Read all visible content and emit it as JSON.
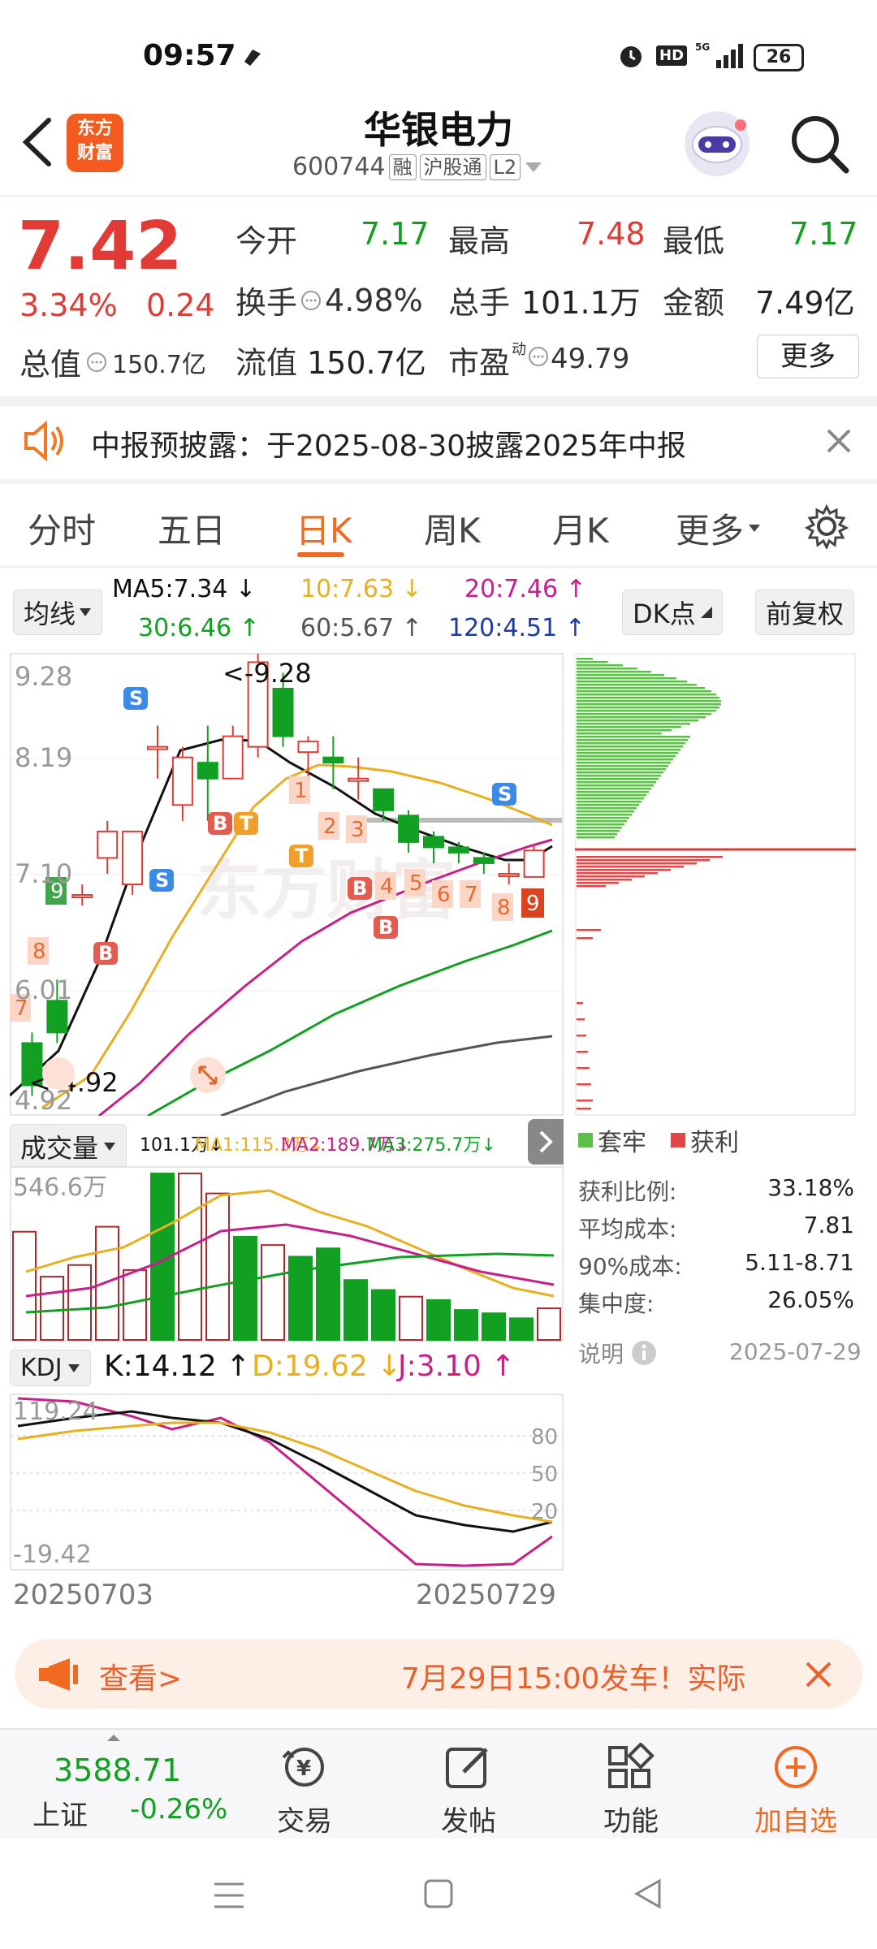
{
  "status": {
    "time": "09:57",
    "battery": "26"
  },
  "header": {
    "title": "华银电力",
    "code": "600744",
    "tags": [
      "融",
      "沪股通",
      "L2"
    ],
    "brand_line1": "东方",
    "brand_line2": "财富"
  },
  "quote": {
    "price": "7.42",
    "change_pct": "3.34%",
    "change_amt": "0.24",
    "open_label": "今开",
    "open": "7.17",
    "high_label": "最高",
    "high": "7.48",
    "low_label": "最低",
    "low": "7.17",
    "turnover_label": "换手",
    "turnover": "4.98%",
    "volume_label": "总手",
    "volume": "101.1万",
    "amount_label": "金额",
    "amount": "7.49亿",
    "mktcap_label": "总值",
    "mktcap": "150.7亿",
    "float_label": "流值",
    "float": "150.7亿",
    "pe_label": "市盈",
    "pe_sup": "动",
    "pe": "49.79",
    "more_button": "更多"
  },
  "notice": {
    "text": "中报预披露：于2025-08-30披露2025年中报"
  },
  "tabs": [
    "分时",
    "五日",
    "日K",
    "周K",
    "月K",
    "更多"
  ],
  "active_tab": 2,
  "ma": {
    "selector": "均线",
    "ma5": "MA5:7.34",
    "ma10": "10:7.63",
    "ma20": "20:7.46",
    "ma30": "30:6.46",
    "ma60": "60:5.67",
    "ma120": "120:4.51",
    "dk_button": "DK点",
    "adj_button": "前复权"
  },
  "kline": {
    "y_labels": [
      "9.28",
      "8.19",
      "7.10",
      "6.01",
      "4.92"
    ],
    "max_marker": "<-9.28",
    "min_marker": "<-4.92",
    "candles": [
      {
        "o": 5.6,
        "c": 5.2,
        "h": 5.7,
        "l": 5.1
      },
      {
        "o": 6.0,
        "c": 5.7,
        "h": 6.2,
        "l": 5.6
      },
      {
        "o": 7.0,
        "c": 7.0,
        "h": 7.1,
        "l": 6.9
      },
      {
        "o": 7.35,
        "c": 7.6,
        "h": 7.7,
        "l": 7.2
      },
      {
        "o": 7.1,
        "c": 7.6,
        "h": 7.6,
        "l": 7.0
      },
      {
        "o": 8.4,
        "c": 8.4,
        "h": 8.6,
        "l": 8.1
      },
      {
        "o": 7.85,
        "c": 8.3,
        "h": 8.4,
        "l": 7.7
      },
      {
        "o": 8.25,
        "c": 8.1,
        "h": 8.6,
        "l": 7.7
      },
      {
        "o": 8.1,
        "c": 8.5,
        "h": 8.6,
        "l": 8.1
      },
      {
        "o": 8.4,
        "c": 9.2,
        "h": 9.28,
        "l": 8.3
      },
      {
        "o": 8.95,
        "c": 8.5,
        "h": 9.1,
        "l": 8.4
      },
      {
        "o": 8.35,
        "c": 8.45,
        "h": 8.5,
        "l": 8.1
      },
      {
        "o": 8.3,
        "c": 8.25,
        "h": 8.5,
        "l": 8.0
      },
      {
        "o": 8.1,
        "c": 8.1,
        "h": 8.3,
        "l": 7.9
      },
      {
        "o": 8.0,
        "c": 7.8,
        "h": 8.0,
        "l": 7.7
      },
      {
        "o": 7.75,
        "c": 7.5,
        "h": 7.8,
        "l": 7.4
      },
      {
        "o": 7.55,
        "c": 7.45,
        "h": 7.6,
        "l": 7.3
      },
      {
        "o": 7.45,
        "c": 7.4,
        "h": 7.5,
        "l": 7.3
      },
      {
        "o": 7.35,
        "c": 7.3,
        "h": 7.4,
        "l": 7.2
      },
      {
        "o": 7.2,
        "c": 7.2,
        "h": 7.3,
        "l": 7.1
      },
      {
        "o": 7.17,
        "c": 7.42,
        "h": 7.48,
        "l": 7.17
      }
    ],
    "labels_s": [
      "S",
      "S",
      "S"
    ],
    "labels_b": [
      "B",
      "B",
      "B",
      "B"
    ],
    "labels_t": [
      "T",
      "T"
    ],
    "nums": [
      "1",
      "2",
      "3",
      "4",
      "5",
      "6",
      "7",
      "8",
      "9"
    ],
    "colors": {
      "up": "#e23a35",
      "down": "#11a022",
      "ma5": "#111111",
      "ma10": "#e8b020",
      "ma20": "#c81e8a",
      "ma30": "#11a022",
      "ma60": "#666666"
    }
  },
  "chips": {
    "legend_trapped": "套牢",
    "legend_profit": "获利",
    "profit_ratio_label": "获利比例:",
    "profit_ratio": "33.18%",
    "avg_cost_label": "平均成本:",
    "avg_cost": "7.81",
    "cost90_label": "90%成本:",
    "cost90": "5.11-8.71",
    "concentration_label": "集中度:",
    "concentration": "26.05%",
    "note_label": "说明",
    "date": "2025-07-29"
  },
  "volume": {
    "selector": "成交量",
    "vol_text": "101.1万",
    "ma1": "MA1:115.3万",
    "ma2": "MA2:189.7万",
    "ma3": "MA3:275.7万",
    "y_label": "546.6万"
  },
  "kdj": {
    "selector": "KDJ",
    "k": "K:14.12",
    "d": "D:19.62",
    "j": "J:3.10",
    "y_top": "119.24",
    "y_bottom": "-19.42",
    "levels": [
      "80",
      "50",
      "20"
    ],
    "date_start": "20250703",
    "date_end": "20250729"
  },
  "ad": {
    "left": "查看>",
    "right": "7月29日15:00发车！实际"
  },
  "bottom": {
    "index_value": "3588.71",
    "index_name": "上证",
    "index_change": "-0.26%",
    "trade": "交易",
    "post": "发帖",
    "func": "功能",
    "add": "加自选"
  }
}
